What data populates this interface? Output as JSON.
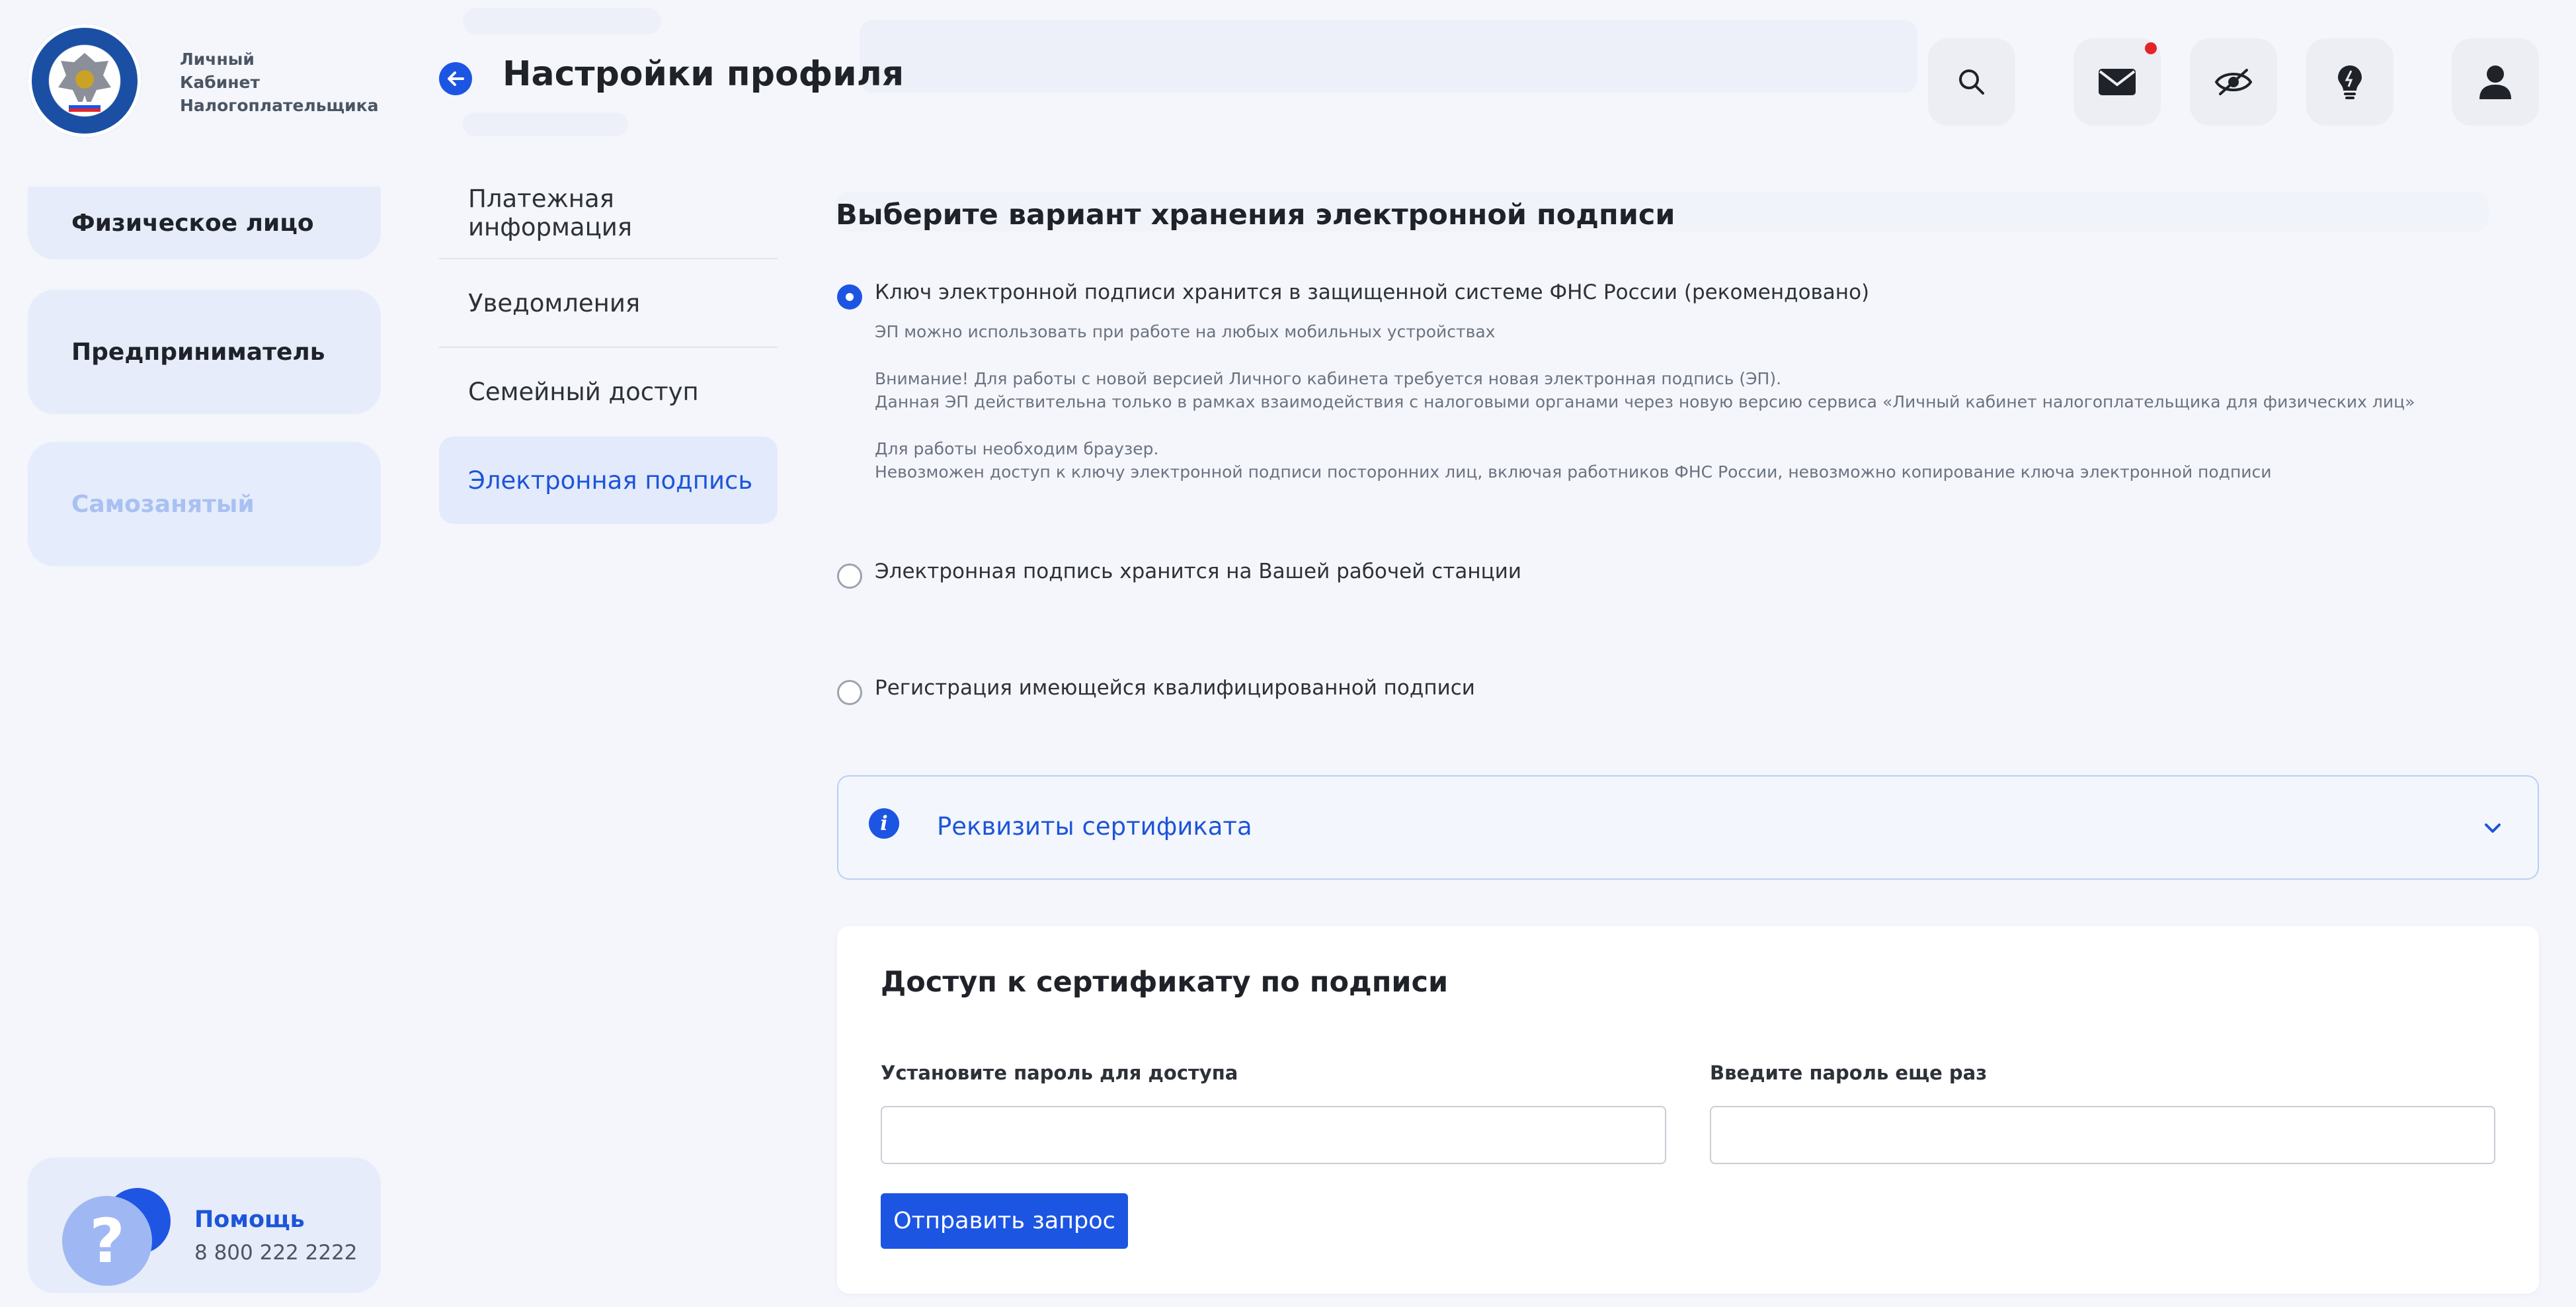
{
  "logo": {
    "line1": "Личный",
    "line2": "Кабинет",
    "line3": "Налогоплательщика"
  },
  "roles": [
    {
      "label": "Физическое лицо"
    },
    {
      "label": "Предприниматель"
    },
    {
      "label": "Самозанятый"
    }
  ],
  "help": {
    "icon": "?",
    "title": "Помощь",
    "phone": "8 800 222 2222"
  },
  "header": {
    "title": "Настройки профиля",
    "icons": [
      "search-icon",
      "mail-icon",
      "eye-off-icon",
      "lightbulb-icon",
      "user-icon"
    ]
  },
  "menu": {
    "items": [
      {
        "label": "Платежная информация"
      },
      {
        "label": "Уведомления"
      },
      {
        "label": "Семейный доступ"
      },
      {
        "label": "Электронная подпись"
      }
    ],
    "active": "Электронная подпись"
  },
  "storage": {
    "title": "Выберите вариант хранения электронной подписи",
    "options": [
      {
        "label": "Ключ электронной подписи хранится в защищенной системе ФНС России (рекомендовано)",
        "checked": true
      },
      {
        "label": "Электронная подпись хранится на Вашей рабочей станции",
        "checked": false
      },
      {
        "label": "Регистрация имеющейся квалифицированной подписи",
        "checked": false
      }
    ],
    "notes": [
      "ЭП можно использовать при работе на любых мобильных устройствах",
      "Внимание! Для работы с новой версией Личного кабинета требуется новая электронная подпись (ЭП).",
      "Данная ЭП действительна только в рамках взаимодействия с налоговыми органами через новую версию сервиса «Личный кабинет налогоплательщика для физических лиц»",
      "Для работы необходим браузер.",
      "Невозможен доступ к ключу электронной подписи посторонних лиц, включая работников ФНС России, невозможно копирование ключа электронной подписи"
    ]
  },
  "certificate": {
    "accordion_title": "Реквизиты сертификата"
  },
  "access": {
    "title": "Доступ к сертификату по подписи",
    "password_label": "Установите пароль для доступа",
    "password_value": "",
    "repeat_label": "Введите пароль еще раз",
    "repeat_value": "",
    "submit_label": "Отправить запрос"
  },
  "colors": {
    "accent": "#1d55e3",
    "notification_dot": "#e3242b",
    "panel_bg": "#e7ecfa"
  }
}
